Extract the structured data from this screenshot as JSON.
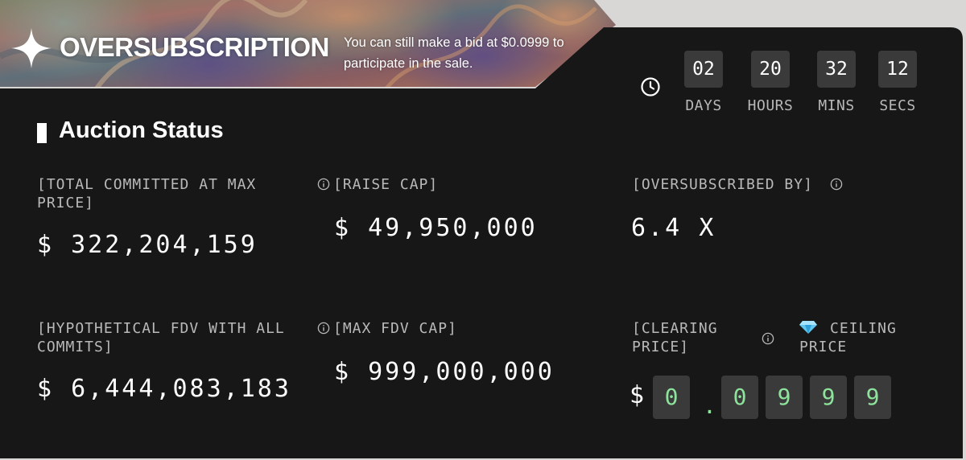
{
  "banner": {
    "title": "OVERSUBSCRIPTION",
    "message": "You can still make a bid at $0.0999 to participate in the sale."
  },
  "countdown": {
    "icon": "clock-icon",
    "units": [
      {
        "value": "02",
        "label": "DAYS"
      },
      {
        "value": "20",
        "label": "HOURS"
      },
      {
        "value": "32",
        "label": "MINS"
      },
      {
        "value": "12",
        "label": "SECS"
      }
    ]
  },
  "section_title": "Auction Status",
  "stats": {
    "total_committed": {
      "label": "[TOTAL COMMITTED AT MAX PRICE]",
      "value": "$ 322,204,159"
    },
    "raise_cap": {
      "label": "[RAISE CAP]",
      "value": "$ 49,950,000"
    },
    "oversubscribed_by": {
      "label": "[OVERSUBSCRIBED BY]",
      "value": "6.4 X"
    },
    "hypothetical_fdv": {
      "label": "[HYPOTHETICAL FDV WITH ALL COMMITS]",
      "value": "$ 6,444,083,183"
    },
    "max_fdv_cap": {
      "label": "[MAX FDV CAP]",
      "value": "$ 999,000,000"
    },
    "clearing_price": {
      "label": "[CLEARING PRICE]",
      "ceiling_label": "CEILING PRICE",
      "ceiling_icon": "gem-icon",
      "currency": "$",
      "digits": [
        "0",
        ".",
        "0",
        "9",
        "9",
        "9"
      ]
    }
  },
  "colors": {
    "panel": "#171717",
    "digit_box": "#3a3a3a",
    "price_digit": "#8ee39c",
    "label": "#b9b9b9",
    "text": "#ffffff"
  }
}
